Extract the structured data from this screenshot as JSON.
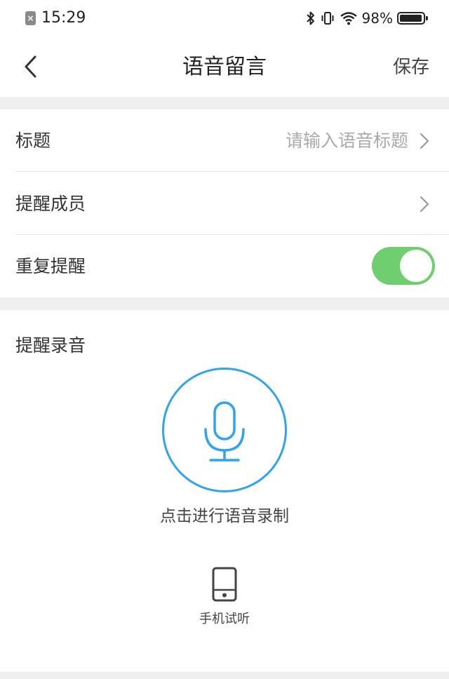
{
  "status_bar": {
    "time": "15:29",
    "battery_text": "98%",
    "battery_level": 0.98
  },
  "nav": {
    "title": "语音留言",
    "save_label": "保存"
  },
  "form": {
    "title_label": "标题",
    "title_placeholder": "请输入语音标题",
    "members_label": "提醒成员",
    "repeat_label": "重复提醒",
    "repeat_on": true
  },
  "recording": {
    "section_title": "提醒录音",
    "hint": "点击进行语音录制",
    "preview_label": "手机试听"
  },
  "colors": {
    "accent": "#2ea3f2",
    "toggle_on": "#6fcf6f"
  },
  "icons": {
    "back": "chevron-left-icon",
    "row_arrow": "chevron-right-icon",
    "mic": "microphone-icon",
    "phone": "phone-icon"
  }
}
